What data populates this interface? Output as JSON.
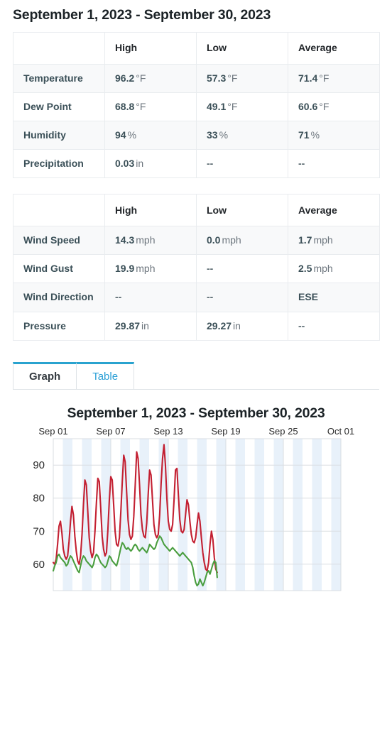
{
  "header": {
    "title": "September 1, 2023 - September 30, 2023"
  },
  "summary_tables": [
    {
      "name": "atmosphere-summary",
      "columns": [
        "",
        "High",
        "Low",
        "Average"
      ],
      "rows": [
        {
          "label": "Temperature",
          "cells": [
            {
              "value": "96.2",
              "unit": "°F"
            },
            {
              "value": "57.3",
              "unit": "°F"
            },
            {
              "value": "71.4",
              "unit": "°F"
            }
          ]
        },
        {
          "label": "Dew Point",
          "cells": [
            {
              "value": "68.8",
              "unit": "°F"
            },
            {
              "value": "49.1",
              "unit": "°F"
            },
            {
              "value": "60.6",
              "unit": "°F"
            }
          ]
        },
        {
          "label": "Humidity",
          "cells": [
            {
              "value": "94",
              "unit": "%"
            },
            {
              "value": "33",
              "unit": "%"
            },
            {
              "value": "71",
              "unit": "%"
            }
          ]
        },
        {
          "label": "Precipitation",
          "cells": [
            {
              "value": "0.03",
              "unit": "in"
            },
            {
              "value": "--",
              "unit": ""
            },
            {
              "value": "--",
              "unit": ""
            }
          ]
        }
      ]
    },
    {
      "name": "wind-pressure-summary",
      "columns": [
        "",
        "High",
        "Low",
        "Average"
      ],
      "rows": [
        {
          "label": "Wind Speed",
          "cells": [
            {
              "value": "14.3",
              "unit": "mph"
            },
            {
              "value": "0.0",
              "unit": "mph"
            },
            {
              "value": "1.7",
              "unit": "mph"
            }
          ]
        },
        {
          "label": "Wind Gust",
          "cells": [
            {
              "value": "19.9",
              "unit": "mph"
            },
            {
              "value": "--",
              "unit": ""
            },
            {
              "value": "2.5",
              "unit": "mph"
            }
          ]
        },
        {
          "label": "Wind Direction",
          "cells": [
            {
              "value": "--",
              "unit": ""
            },
            {
              "value": "--",
              "unit": ""
            },
            {
              "value": "ESE",
              "unit": ""
            }
          ]
        },
        {
          "label": "Pressure",
          "cells": [
            {
              "value": "29.87",
              "unit": "in"
            },
            {
              "value": "29.27",
              "unit": "in"
            },
            {
              "value": "--",
              "unit": ""
            }
          ]
        }
      ]
    }
  ],
  "tabs": {
    "active": "Graph",
    "items": [
      {
        "label": "Graph",
        "active": true
      },
      {
        "label": "Table",
        "active": false
      }
    ],
    "accent_color": "#29a3cf"
  },
  "chart_data": {
    "type": "line",
    "title": "September 1, 2023 - September 30, 2023",
    "xlabel": "",
    "ylabel": "",
    "grid": true,
    "legend_position": "none",
    "xlim": [
      "Sep 01",
      "Oct 01"
    ],
    "ylim": [
      52,
      98
    ],
    "yticks": [
      60,
      70,
      80,
      90
    ],
    "xticks": [
      "Sep 01",
      "Sep 07",
      "Sep 13",
      "Sep 19",
      "Sep 25",
      "Oct 01"
    ],
    "xtick_days": [
      0,
      6,
      12,
      18,
      24,
      30
    ],
    "day_band_shading": true,
    "series": [
      {
        "name": "Temperature",
        "color": "#c32032",
        "x": [
          0,
          0.15,
          0.3,
          0.45,
          0.6,
          0.75,
          0.9,
          1.05,
          1.2,
          1.35,
          1.5,
          1.65,
          1.8,
          1.95,
          2.1,
          2.25,
          2.4,
          2.55,
          2.7,
          2.85,
          3,
          3.15,
          3.3,
          3.45,
          3.6,
          3.75,
          3.9,
          4.05,
          4.2,
          4.35,
          4.5,
          4.65,
          4.8,
          4.95,
          5.1,
          5.25,
          5.4,
          5.55,
          5.7,
          5.85,
          6,
          6.15,
          6.3,
          6.45,
          6.6,
          6.75,
          6.9,
          7.05,
          7.2,
          7.35,
          7.5,
          7.65,
          7.8,
          7.95,
          8.1,
          8.25,
          8.4,
          8.55,
          8.7,
          8.85,
          9,
          9.15,
          9.3,
          9.45,
          9.6,
          9.75,
          9.9,
          10.05,
          10.2,
          10.35,
          10.5,
          10.65,
          10.8,
          10.95,
          11.1,
          11.25,
          11.4,
          11.55,
          11.7,
          11.85,
          12,
          12.15,
          12.3,
          12.45,
          12.6,
          12.75,
          12.9,
          13.05,
          13.2,
          13.35,
          13.5,
          13.65,
          13.8,
          13.95,
          14.1,
          14.25,
          14.4,
          14.55,
          14.7,
          14.85,
          15,
          15.15,
          15.3,
          15.45,
          15.6,
          15.75,
          15.9,
          16.05,
          16.2,
          16.35,
          16.5,
          16.65,
          16.8,
          16.95,
          17.1
        ],
        "values": [
          60.5,
          60.0,
          61.5,
          66.0,
          71.5,
          73.0,
          69.5,
          64.5,
          62.5,
          61.5,
          62.5,
          67.0,
          73.0,
          77.5,
          75.0,
          68.5,
          64.0,
          61.0,
          60.0,
          62.5,
          69.0,
          78.0,
          85.5,
          84.0,
          76.0,
          68.0,
          64.0,
          62.0,
          63.5,
          70.0,
          78.5,
          86.0,
          85.0,
          77.0,
          68.5,
          64.5,
          62.5,
          63.5,
          70.5,
          79.5,
          86.5,
          85.5,
          78.0,
          70.0,
          66.0,
          65.5,
          68.0,
          76.0,
          85.0,
          93.0,
          91.0,
          82.0,
          73.5,
          69.0,
          67.5,
          68.5,
          74.5,
          84.0,
          94.0,
          92.0,
          84.0,
          75.0,
          70.5,
          68.5,
          68.0,
          72.5,
          81.0,
          88.5,
          87.0,
          79.5,
          72.0,
          69.0,
          68.0,
          69.0,
          75.0,
          84.5,
          92.0,
          96.2,
          90.0,
          80.0,
          73.0,
          70.5,
          70.0,
          72.0,
          79.5,
          88.5,
          89.0,
          81.0,
          73.5,
          70.0,
          69.5,
          70.5,
          75.0,
          79.5,
          78.0,
          73.0,
          69.0,
          67.0,
          66.5,
          68.0,
          72.0,
          75.5,
          73.0,
          68.0,
          63.5,
          60.5,
          58.5,
          58.0,
          60.5,
          66.0,
          70.0,
          67.5,
          62.0,
          58.5,
          57.5
        ]
      },
      {
        "name": "Dew Point",
        "color": "#4a9e3f",
        "x": [
          0,
          0.15,
          0.3,
          0.45,
          0.6,
          0.75,
          0.9,
          1.05,
          1.2,
          1.35,
          1.5,
          1.65,
          1.8,
          1.95,
          2.1,
          2.25,
          2.4,
          2.55,
          2.7,
          2.85,
          3,
          3.15,
          3.3,
          3.45,
          3.6,
          3.75,
          3.9,
          4.05,
          4.2,
          4.35,
          4.5,
          4.65,
          4.8,
          4.95,
          5.1,
          5.25,
          5.4,
          5.55,
          5.7,
          5.85,
          6,
          6.15,
          6.3,
          6.45,
          6.6,
          6.75,
          6.9,
          7.05,
          7.2,
          7.35,
          7.5,
          7.65,
          7.8,
          7.95,
          8.1,
          8.25,
          8.4,
          8.55,
          8.7,
          8.85,
          9,
          9.15,
          9.3,
          9.45,
          9.6,
          9.75,
          9.9,
          10.05,
          10.2,
          10.35,
          10.5,
          10.65,
          10.8,
          10.95,
          11.1,
          11.25,
          11.4,
          11.55,
          11.7,
          11.85,
          12,
          12.15,
          12.3,
          12.45,
          12.6,
          12.75,
          12.9,
          13.05,
          13.2,
          13.35,
          13.5,
          13.65,
          13.8,
          13.95,
          14.1,
          14.25,
          14.4,
          14.55,
          14.7,
          14.85,
          15,
          15.15,
          15.3,
          15.45,
          15.6,
          15.75,
          15.9,
          16.05,
          16.2,
          16.35,
          16.5,
          16.65,
          16.8,
          16.95,
          17.1
        ],
        "values": [
          58.0,
          59.5,
          60.5,
          62.5,
          63.0,
          62.0,
          61.5,
          61.0,
          60.5,
          59.5,
          60.0,
          61.5,
          62.5,
          62.0,
          61.0,
          60.0,
          59.0,
          58.0,
          57.5,
          59.5,
          61.5,
          62.5,
          62.0,
          61.0,
          60.5,
          60.0,
          59.5,
          59.0,
          60.0,
          62.0,
          63.0,
          62.5,
          61.5,
          60.5,
          60.0,
          59.5,
          59.0,
          59.5,
          61.0,
          62.5,
          62.0,
          61.0,
          60.5,
          60.0,
          59.5,
          61.0,
          63.0,
          65.0,
          66.5,
          66.0,
          65.0,
          64.5,
          65.0,
          64.5,
          64.0,
          64.5,
          65.5,
          66.0,
          65.5,
          64.5,
          64.0,
          64.5,
          65.0,
          64.5,
          64.0,
          63.5,
          64.5,
          66.0,
          65.5,
          65.0,
          64.5,
          65.0,
          66.5,
          67.5,
          68.5,
          68.0,
          67.0,
          66.0,
          65.5,
          65.0,
          64.5,
          64.0,
          64.5,
          65.0,
          64.5,
          64.0,
          63.5,
          63.0,
          62.5,
          63.0,
          63.5,
          63.0,
          62.5,
          62.0,
          61.5,
          61.0,
          60.5,
          59.0,
          56.5,
          54.5,
          53.5,
          54.0,
          55.5,
          54.5,
          53.5,
          54.5,
          56.0,
          57.5,
          58.0,
          57.0,
          58.5,
          60.0,
          61.0,
          60.5,
          56.0
        ]
      }
    ]
  }
}
